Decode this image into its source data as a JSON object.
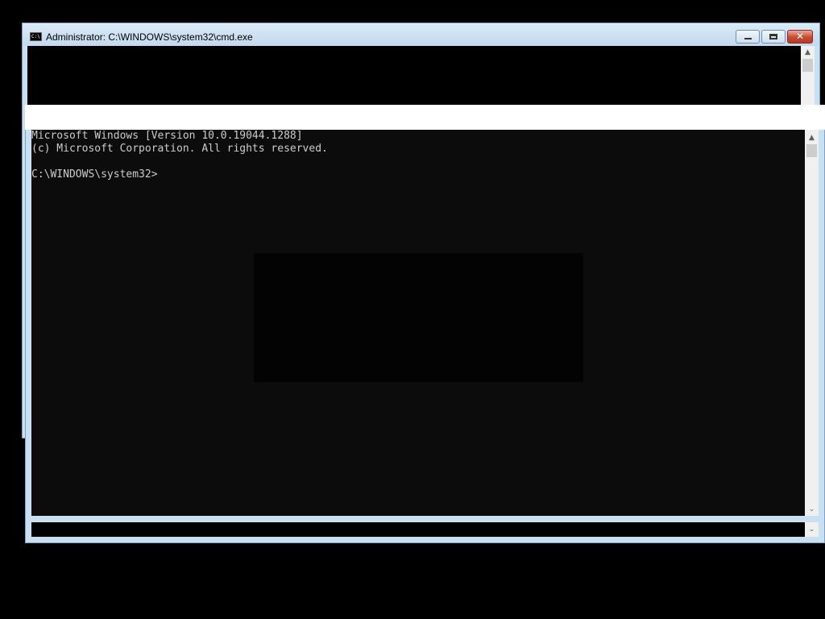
{
  "window": {
    "title": "Administrator: C:\\WINDOWS\\system32\\cmd.exe",
    "icon": "cmd-icon",
    "icon_text": "C:\\",
    "buttons": {
      "minimize": "minimize-icon",
      "maximize": "maximize-icon",
      "close": "close-icon",
      "close_glyph": "✕"
    }
  },
  "console": {
    "lines": [
      "Microsoft Windows [Version 10.0.19044.1288]",
      "(c) Microsoft Corporation. All rights reserved.",
      "",
      "C:\\WINDOWS\\system32>"
    ],
    "background_color": "#0c0c0c",
    "text_color": "#cccccc"
  },
  "scrollbar": {
    "up_arrow": "▲",
    "down_arrow": "⌄"
  }
}
